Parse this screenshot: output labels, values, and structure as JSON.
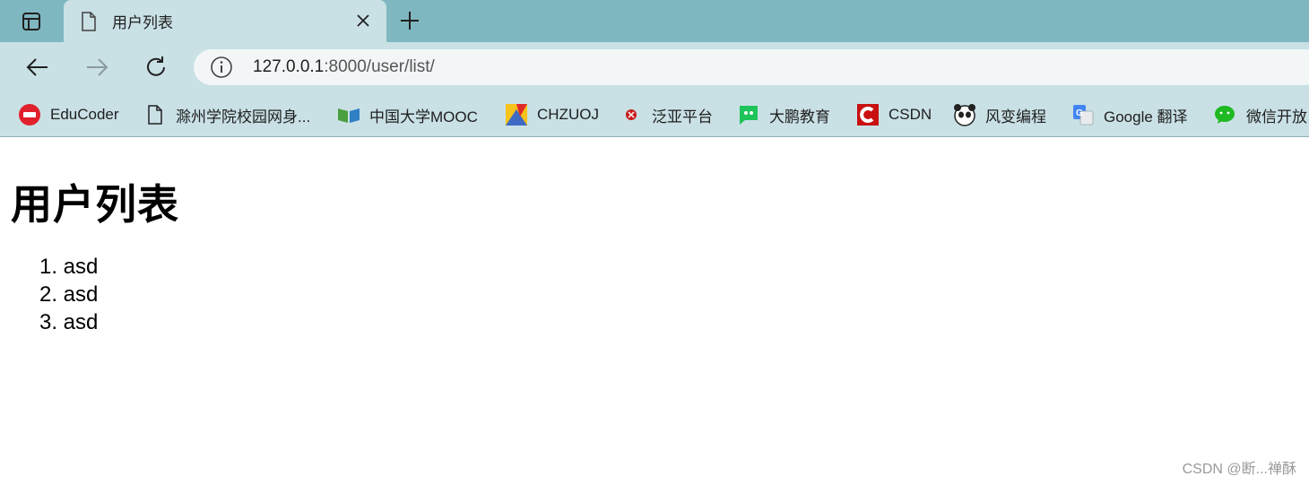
{
  "tab": {
    "title": "用户列表"
  },
  "address_bar": {
    "host": "127.0.0.1",
    "rest": ":8000/user/list/"
  },
  "bookmarks": [
    {
      "label": "EduCoder",
      "icon": "educoder-logo-icon"
    },
    {
      "label": "滁州学院校园网身...",
      "icon": "document-icon"
    },
    {
      "label": "中国大学MOOC",
      "icon": "mooc-logo-icon"
    },
    {
      "label": "CHZUOJ",
      "icon": "chzuoj-logo-icon"
    },
    {
      "label": "泛亚平台",
      "icon": "fanya-logo-icon"
    },
    {
      "label": "大鹏教育",
      "icon": "dapeng-logo-icon"
    },
    {
      "label": "CSDN",
      "icon": "csdn-logo-icon"
    },
    {
      "label": "风变编程",
      "icon": "fengbian-logo-icon"
    },
    {
      "label": "Google 翻译",
      "icon": "google-translate-icon"
    },
    {
      "label": "微信开放",
      "icon": "wechat-icon"
    }
  ],
  "page": {
    "heading": "用户列表",
    "items": [
      "1. asd",
      "2. asd",
      "3. asd"
    ]
  },
  "watermark": "CSDN @断...禅酥",
  "colors": {
    "tabstrip": "#7fb7c0",
    "toolbar": "#c9e0e5",
    "address_bar": "#f2f6f7"
  }
}
